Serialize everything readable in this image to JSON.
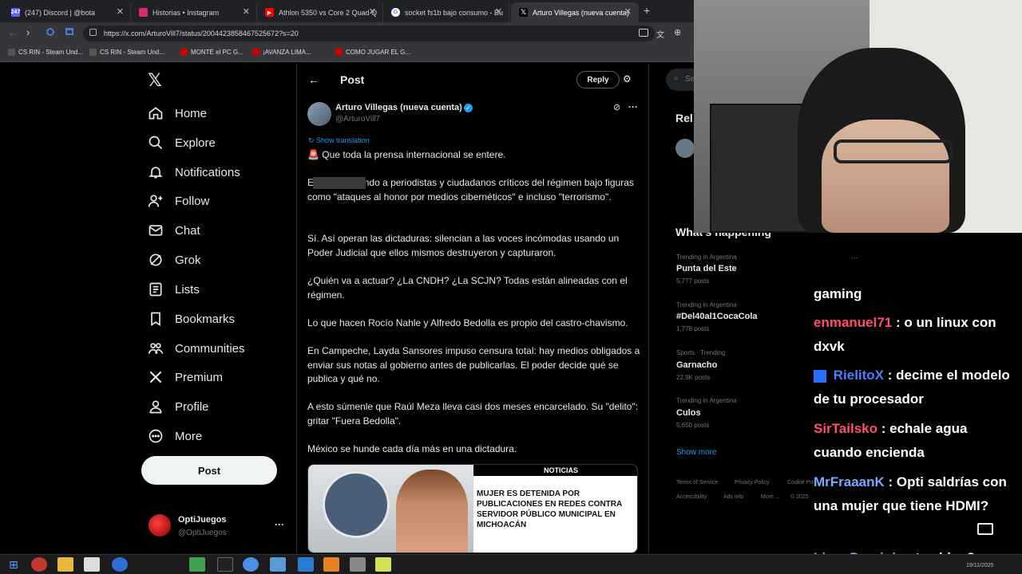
{
  "browser": {
    "tabs": [
      {
        "label": "(247) Discord | @bota",
        "favicon": "discord-icon",
        "color": "#5865f2"
      },
      {
        "label": "Historias • Instagram",
        "favicon": "instagram-icon",
        "color": "#d62976"
      },
      {
        "label": "Athlon 5350 vs Core 2 Quad Q",
        "favicon": "youtube-icon",
        "color": "#ff0000"
      },
      {
        "label": "socket fs1b bajo consumo - Bu",
        "favicon": "google-icon",
        "color": "#4285f4"
      },
      {
        "label": "Arturo Villegas (nueva cuenta)",
        "favicon": "x-icon",
        "color": "#000000"
      }
    ],
    "url": "https://x.com/ArturoVill7/status/2004423858467525672?s=20",
    "bookmarks": [
      "CS RIN - Steam Und...",
      "CS RIN - Steam Und...",
      "MONTÉ el PC G...",
      "¡AVANZA LIMA...",
      "COMO JUGAR EL G..."
    ]
  },
  "sidebar": {
    "nav": [
      {
        "label": "Home",
        "icon": "home-icon"
      },
      {
        "label": "Explore",
        "icon": "search-icon"
      },
      {
        "label": "Notifications",
        "icon": "bell-icon"
      },
      {
        "label": "Follow",
        "icon": "follow-icon"
      },
      {
        "label": "Chat",
        "icon": "mail-icon"
      },
      {
        "label": "Grok",
        "icon": "grok-icon"
      },
      {
        "label": "Lists",
        "icon": "lists-icon"
      },
      {
        "label": "Bookmarks",
        "icon": "bookmark-icon"
      },
      {
        "label": "Communities",
        "icon": "communities-icon"
      },
      {
        "label": "Premium",
        "icon": "x-logo-icon"
      },
      {
        "label": "Profile",
        "icon": "profile-icon"
      },
      {
        "label": "More",
        "icon": "more-icon"
      }
    ],
    "post_button": "Post",
    "account": {
      "name": "OptiJuegos",
      "handle": "@OptiJuegos"
    }
  },
  "header": {
    "title": "Post",
    "reply_button": "Reply"
  },
  "tweet": {
    "author_name": "Arturo Villegas (nueva cuenta)",
    "author_handle": "@ArturoVill7",
    "show_translation": "Show translation",
    "paragraphs": [
      "Que toda la prensa internacional se entere.",
      "E tán deteniendo a periodistas y ciudadanos críticos del régimen bajo figuras como \"ataques al honor por medios cibernéticos\" e incluso \"terrorismo\".",
      "Sí. Así operan las dictaduras: silencian a las voces incómodas usando un Poder Judicial que ellos mismos destruyeron y capturaron.",
      "¿Quién va a actuar? ¿La CNDH? ¿La SCJN? Todas están alineadas con el régimen.",
      "Lo que hacen Rocío Nahle y Alfredo Bedolla es propio del castro-chavismo.",
      "En Campeche, Layda Sansores impuso censura total: hay medios obligados a enviar sus notas al gobierno antes de publicarlas. El poder decide qué se publica y qué no.",
      "A esto súmenle que Raúl Meza lleva casi dos meses encarcelado. Su \"delito\": gritar \"Fuera Bedolla\".",
      "México se hunde cada día más en una dictadura."
    ],
    "image": {
      "badge": "NOTICIAS",
      "headline": "MUJER ES DETENIDA POR PUBLICACIONES EN REDES CONTRA SERVIDOR PÚBLICO MUNICIPAL EN MICHOACÁN"
    }
  },
  "right_column": {
    "search_placeholder": "Se",
    "relevant_heading": "Rel",
    "happening_heading": "What's happening",
    "trends": [
      {
        "category": "Trending in Argentina",
        "name": "Punta del Este",
        "count": "5,777 posts"
      },
      {
        "category": "Trending in Argentina",
        "name": "#Del40al1CocaCola",
        "count": "1,778 posts"
      },
      {
        "category": "Sports · Trending",
        "name": "Garnacho",
        "count": "22.9K posts"
      },
      {
        "category": "Trending in Argentina",
        "name": "Culos",
        "count": "5,650 posts"
      }
    ],
    "show_more": "Show more",
    "footer": [
      "Terms of Service",
      "Privacy Policy",
      "Cookie Policy",
      "Accessibility",
      "Ads info",
      "More ...",
      "© 2025"
    ],
    "more_dots": "..."
  },
  "stream_chat": [
    {
      "user": "",
      "message": "gaming",
      "color": "#ffffff"
    },
    {
      "user": "enmanuel71",
      "message": ": o un linux con dxvk",
      "color": "#ff4d6d"
    },
    {
      "user": "RielitoX",
      "message": ": decime el modelo de tu procesador",
      "color": "#4f7cff"
    },
    {
      "user": "SirTailsko",
      "message": ": echale agua cuando encienda",
      "color": "#ff4d6d"
    },
    {
      "user": "MrFraaanK",
      "message": ": Opti saldrías con una mujer que tiene HDMI?",
      "color": "#79a8ff"
    },
    {
      "user": "LinuxDominic",
      "message": ": tas bien?",
      "color": "#9aa8ff"
    }
  ],
  "taskbar": {
    "date": "19/11/2025"
  }
}
